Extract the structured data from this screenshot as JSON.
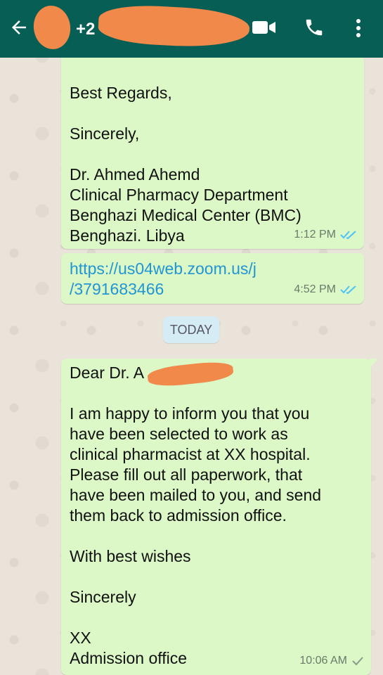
{
  "header": {
    "contact_partial": "+2",
    "accent_color": "#075e54",
    "icons": [
      "back-arrow-icon",
      "video-call-icon",
      "phone-icon",
      "more-vert-icon"
    ]
  },
  "messages": [
    {
      "text": "Best Regards,\n\nSincerely,\n\nDr. Ahmed Ahemd\nClinical Pharmacy Department\nBenghazi Medical Center (BMC)\nBenghazi. Libya",
      "time": "1:12 PM",
      "status": "read"
    },
    {
      "text": "https://us04web.zoom.us/j\n/3791683466",
      "time": "4:52 PM",
      "status": "read"
    },
    {
      "text": "Dear Dr. A\n\nI am happy to inform you that you\nhave been selected to work as\nclinical pharmacist at XX hospital.\nPlease fill out all paperwork, that\nhave been mailed to you, and send\nthem back to admission office.\n\nWith best wishes\n\nSincerely\n\nXX\nAdmission office",
      "time": "10:06 AM",
      "status": "sent"
    }
  ],
  "date_divider": "TODAY"
}
